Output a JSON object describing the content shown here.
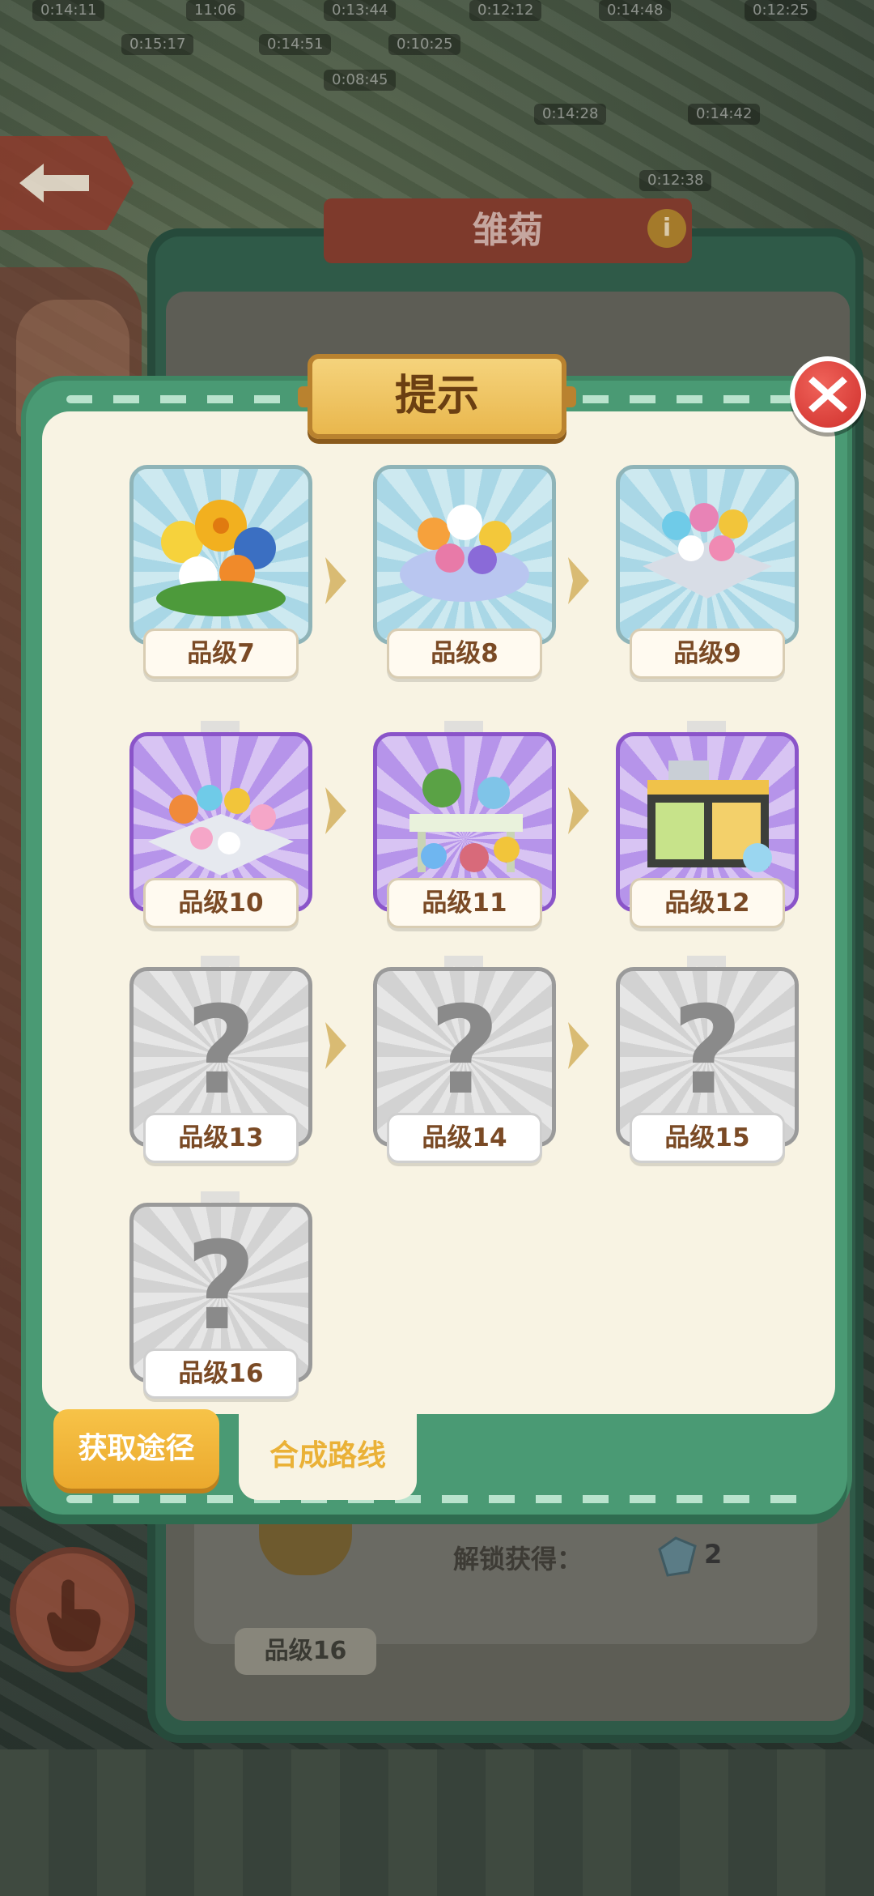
{
  "background": {
    "timers": [
      "0:14:11",
      "11:06",
      "0:13:44",
      "0:12:12",
      "0:14:48",
      "0:12:25",
      "0:15:17",
      "0:14:51",
      "0:10:25",
      "0:08:45",
      "0:14:28",
      "0:14:42",
      "0:12:38"
    ],
    "title": "雏菊",
    "info_icon": "i",
    "unlock_label": "解锁获得：",
    "gem_count": "2",
    "bottom_level": "品级16"
  },
  "dialog": {
    "title": "提示",
    "items": [
      {
        "level": "品级7",
        "style": "blue",
        "art": "bouquet"
      },
      {
        "level": "品级8",
        "style": "blue",
        "art": "bowl"
      },
      {
        "level": "品级9",
        "style": "blue",
        "art": "planter"
      },
      {
        "level": "品级10",
        "style": "purple",
        "art": "flowerbed"
      },
      {
        "level": "品级11",
        "style": "purple",
        "art": "stand"
      },
      {
        "level": "品级12",
        "style": "purple",
        "art": "shelf"
      },
      {
        "level": "品级13",
        "style": "gray",
        "art": "unknown"
      },
      {
        "level": "品级14",
        "style": "gray",
        "art": "unknown"
      },
      {
        "level": "品级15",
        "style": "gray",
        "art": "unknown"
      },
      {
        "level": "品级16",
        "style": "gray",
        "art": "unknown"
      }
    ],
    "tabs": {
      "get_method": "获取途径",
      "merge_route": "合成路线"
    }
  },
  "colors": {
    "dialog_green": "#4a9a74",
    "panel_cream": "#f8f3e3",
    "tab_active_orange": "#f7c348",
    "close_red": "#cf2f2b",
    "rare_purple": "#8a54c9",
    "label_brown": "#7a4a25"
  },
  "icons": [
    "back-arrow-icon",
    "info-icon",
    "close-icon",
    "hand-pointer-icon",
    "gem-icon",
    "question-mark-icon",
    "chevron-right-icon"
  ]
}
